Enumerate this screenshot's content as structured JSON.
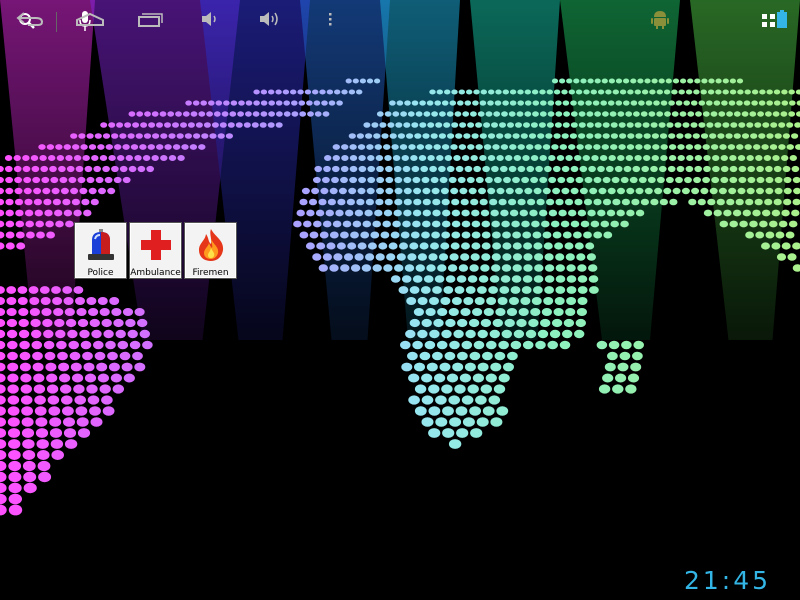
{
  "status_bar": {
    "clock": "21:45"
  },
  "top_bar": {
    "search_icon": "search-icon",
    "voice_icon": "microphone-icon",
    "apps_icon": "all-apps-grid-icon"
  },
  "widget": {
    "tiles": [
      {
        "label": "Police",
        "icon": "police-siren-icon"
      },
      {
        "label": "Ambulance",
        "icon": "red-cross-icon"
      },
      {
        "label": "Firemen",
        "icon": "fire-icon"
      }
    ]
  },
  "navbar": {
    "back_icon": "back-icon",
    "home_icon": "home-icon",
    "recent_icon": "recent-apps-icon",
    "volume_down_icon": "volume-down-icon",
    "volume_up_icon": "volume-up-icon",
    "menu_icon": "overflow-menu-icon",
    "notification_icon": "android-notification-icon",
    "battery_icon": "battery-icon"
  },
  "colors": {
    "accent": "#33b5e5",
    "cross_red": "#e02020"
  }
}
